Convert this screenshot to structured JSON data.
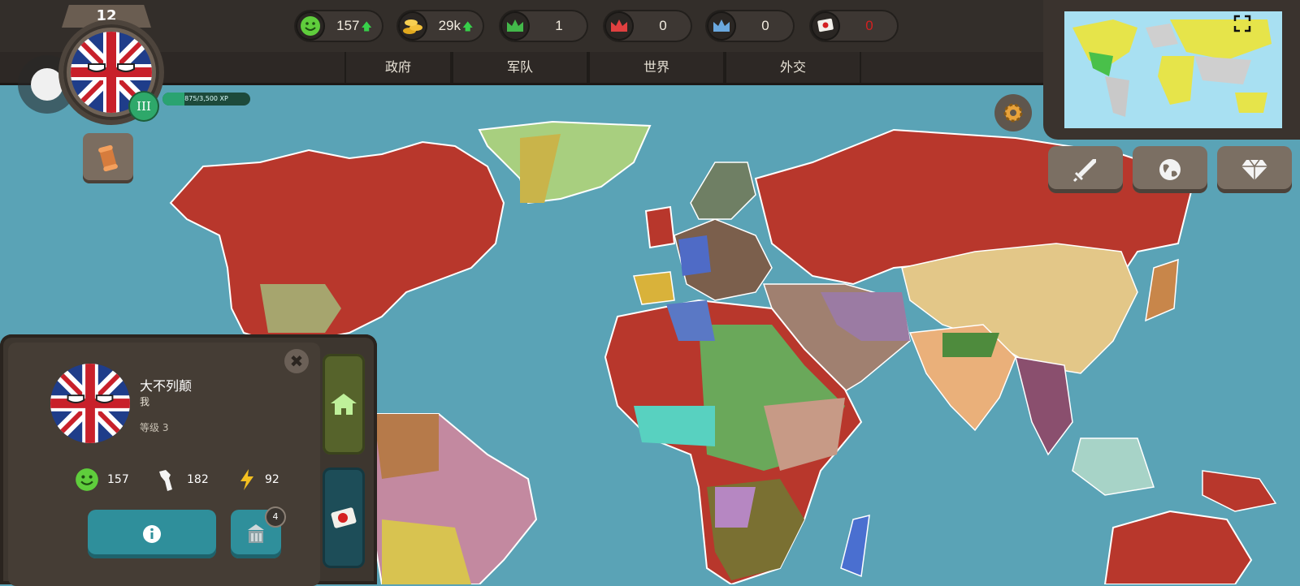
{
  "player": {
    "level": "12",
    "rank": "III",
    "xp_text": "875/3,500 XP",
    "xp_fraction": 0.25
  },
  "resources": [
    {
      "name": "happiness",
      "value": "157",
      "trend": "up",
      "icon": "smiley-icon"
    },
    {
      "name": "gold",
      "value": "29k",
      "trend": "up",
      "icon": "coins-icon"
    },
    {
      "name": "allies",
      "value": "1",
      "trend": "",
      "icon": "green-crown-icon"
    },
    {
      "name": "enemies",
      "value": "0",
      "trend": "",
      "icon": "red-crown-icon"
    },
    {
      "name": "vassals",
      "value": "0",
      "trend": "",
      "icon": "blue-crown-icon"
    },
    {
      "name": "cards",
      "value": "0",
      "trend": "",
      "icon": "card-icon",
      "value_color": "#d42020"
    }
  ],
  "tabs": [
    "政府",
    "军队",
    "世界",
    "外交"
  ],
  "country_panel": {
    "name": "大不列颠",
    "subtitle": "我",
    "level_label": "等级 3",
    "happiness": "157",
    "manpower": "182",
    "energy": "92",
    "building_badge": "4"
  },
  "colors": {
    "ocean": "#5aa3b6",
    "player_red": "#b8372c",
    "ui_dark": "#332e2a",
    "teal_button": "#2f8f9b"
  }
}
